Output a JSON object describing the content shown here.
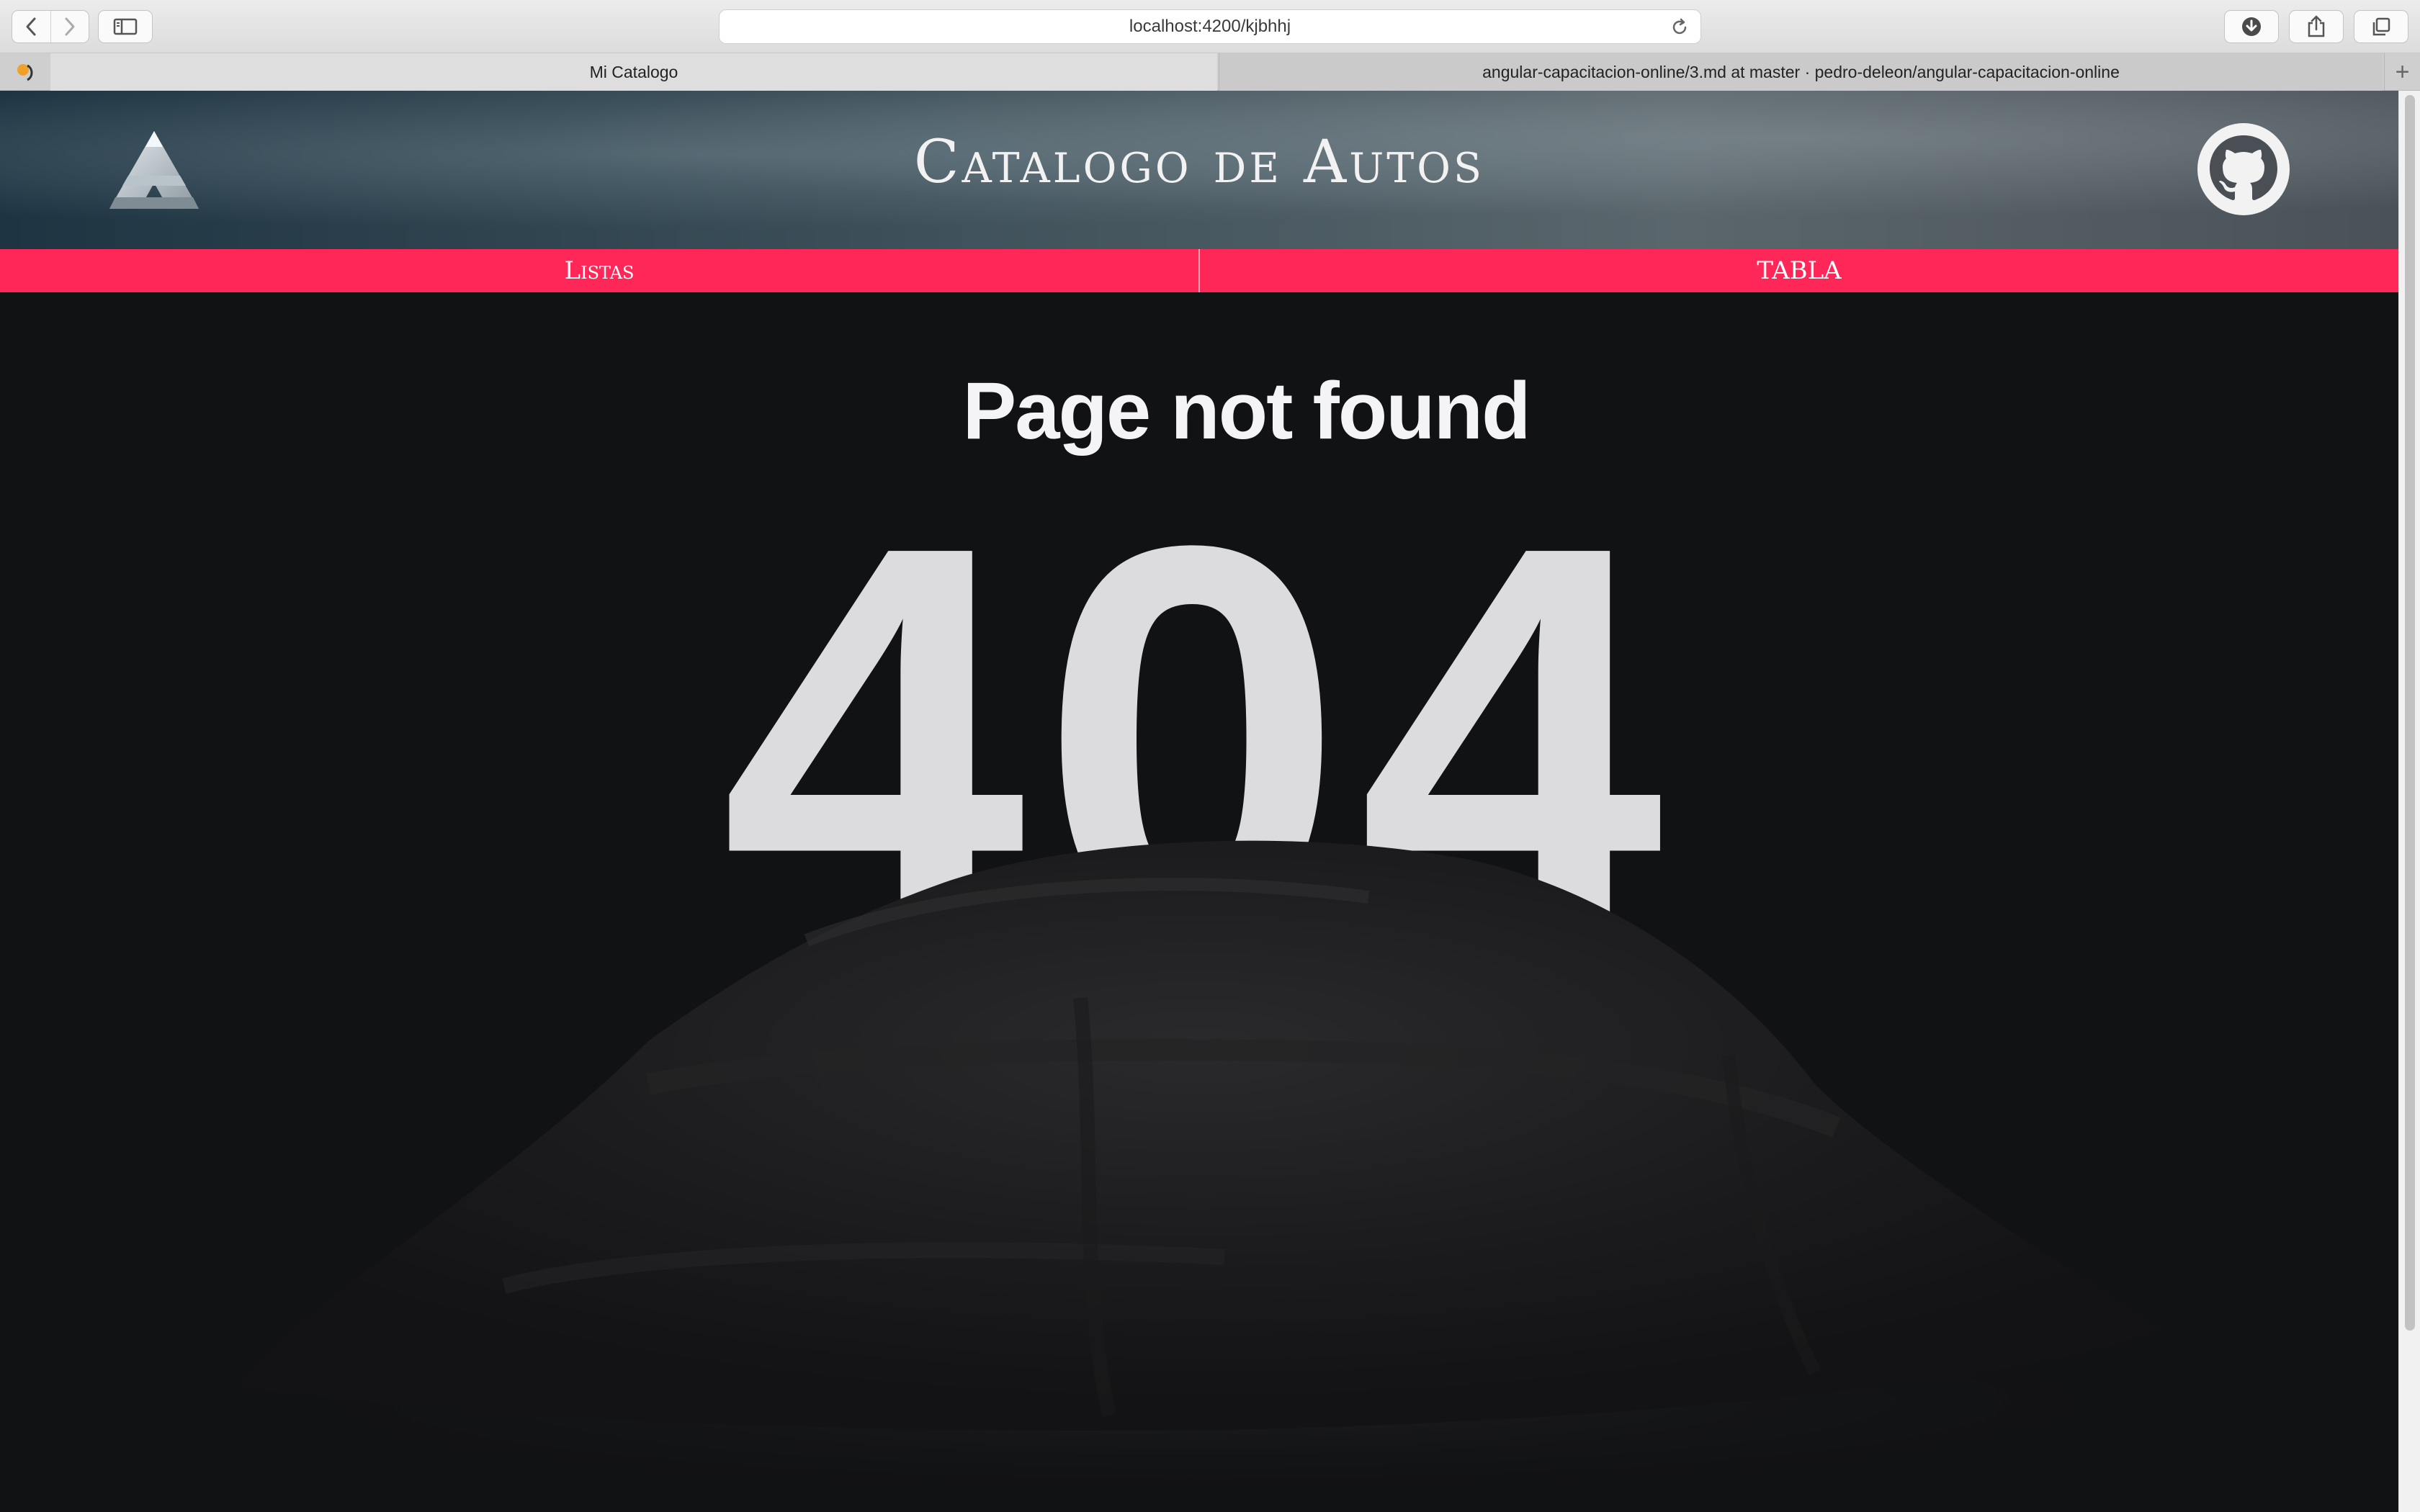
{
  "browser": {
    "url": "localhost:4200/kjbhhj",
    "tabs": [
      {
        "title": "Mi Catalogo",
        "active": true
      },
      {
        "title": "angular-capacitacion-online/3.md at master · pedro-deleon/angular-capacitacion-online",
        "active": false
      }
    ]
  },
  "site": {
    "title": "Catalogo de Autos",
    "logo": "triangle-logo-icon",
    "github_icon": "github-icon"
  },
  "menu": {
    "items": [
      {
        "label": "Listas"
      },
      {
        "label": "TABLA"
      }
    ]
  },
  "not_found": {
    "heading": "Page not found",
    "code": "404"
  },
  "colors": {
    "menu_accent": "#ff2757",
    "page_background": "#111214",
    "code_color": "#dcdcde"
  }
}
